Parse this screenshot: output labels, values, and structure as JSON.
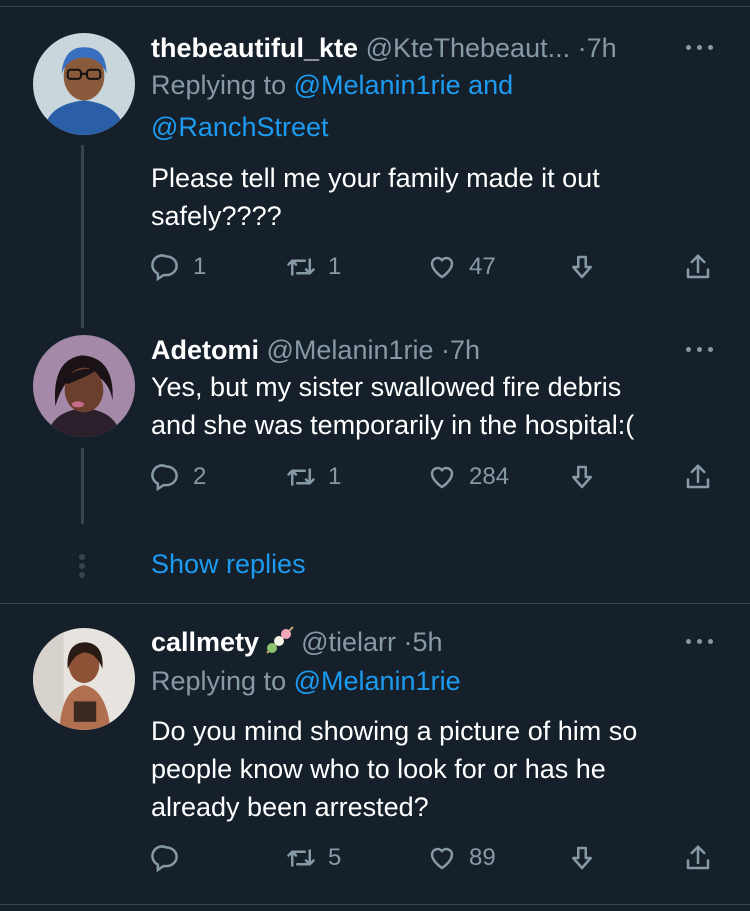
{
  "tweets": [
    {
      "name": "thebeautiful_kte",
      "handle": "@KteThebeaut...",
      "time": "7h",
      "replying_prefix": "Replying to",
      "replying_mention_1": "@Melanin1rie",
      "replying_and": "and",
      "replying_mention_2": "@RanchStreet",
      "text_line_1": "Please tell me your family made it out",
      "text_line_2": "safely????",
      "replies": "1",
      "retweets": "1",
      "likes": "47"
    },
    {
      "name": "Adetomi",
      "handle": "@Melanin1rie",
      "time": "7h",
      "text_line_1": "Yes, but my sister swallowed fire debris",
      "text_line_2": "and she was temporarily in the hospital:(",
      "replies": "2",
      "retweets": "1",
      "likes": "284"
    },
    {
      "name": "callmety",
      "handle": "@tielarr",
      "time": "5h",
      "replying_prefix": "Replying to",
      "replying_mention_1": "@Melanin1rie",
      "text_line_1": "Do you mind showing a picture of him so",
      "text_line_2": "people know who to look for or has he",
      "text_line_3": "already been arrested?",
      "replies": "",
      "retweets": "5",
      "likes": "89"
    }
  ],
  "thread": {
    "show_replies": "Show replies"
  },
  "separator": "·",
  "colors": {
    "background": "#15202b",
    "text": "#ffffff",
    "secondary": "#8899a6",
    "link": "#1d9bf0",
    "divider": "#38444d"
  },
  "icons": [
    "reply-icon",
    "retweet-icon",
    "like-icon",
    "bookmark-icon",
    "share-icon",
    "more-icon"
  ]
}
